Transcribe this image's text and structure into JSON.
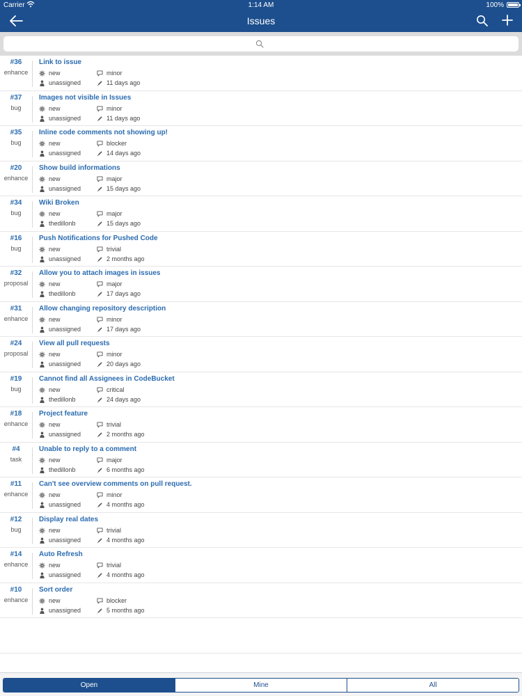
{
  "status_bar": {
    "carrier": "Carrier",
    "time": "1:14 AM",
    "battery": "100%"
  },
  "nav": {
    "title": "Issues"
  },
  "search": {
    "placeholder": ""
  },
  "issues": [
    {
      "number": "#36",
      "kind": "enhance",
      "title": "Link to issue",
      "status": "new",
      "assignee": "unassigned",
      "priority": "minor",
      "updated": "11 days ago"
    },
    {
      "number": "#37",
      "kind": "bug",
      "title": "Images not visible in Issues",
      "status": "new",
      "assignee": "unassigned",
      "priority": "minor",
      "updated": "11 days ago"
    },
    {
      "number": "#35",
      "kind": "bug",
      "title": "Inline code comments not showing up!",
      "status": "new",
      "assignee": "unassigned",
      "priority": "blocker",
      "updated": "14 days ago"
    },
    {
      "number": "#20",
      "kind": "enhance",
      "title": "Show build informations",
      "status": "new",
      "assignee": "unassigned",
      "priority": "major",
      "updated": "15 days ago"
    },
    {
      "number": "#34",
      "kind": "bug",
      "title": "Wiki Broken",
      "status": "new",
      "assignee": "thedillonb",
      "priority": "major",
      "updated": "15 days ago"
    },
    {
      "number": "#16",
      "kind": "bug",
      "title": "Push Notifications for Pushed Code",
      "status": "new",
      "assignee": "unassigned",
      "priority": "trivial",
      "updated": "2 months ago"
    },
    {
      "number": "#32",
      "kind": "proposal",
      "title": "Allow you to attach images in issues",
      "status": "new",
      "assignee": "thedillonb",
      "priority": "major",
      "updated": "17 days ago"
    },
    {
      "number": "#31",
      "kind": "enhance",
      "title": "Allow changing repository description",
      "status": "new",
      "assignee": "unassigned",
      "priority": "minor",
      "updated": "17 days ago"
    },
    {
      "number": "#24",
      "kind": "proposal",
      "title": "View all pull requests",
      "status": "new",
      "assignee": "unassigned",
      "priority": "minor",
      "updated": "20 days ago"
    },
    {
      "number": "#19",
      "kind": "bug",
      "title": "Cannot find all Assignees in CodeBucket",
      "status": "new",
      "assignee": "thedillonb",
      "priority": "critical",
      "updated": "24 days ago"
    },
    {
      "number": "#18",
      "kind": "enhance",
      "title": "Project feature",
      "status": "new",
      "assignee": "unassigned",
      "priority": "trivial",
      "updated": "2 months ago"
    },
    {
      "number": "#4",
      "kind": "task",
      "title": "Unable to reply to a comment",
      "status": "new",
      "assignee": "thedillonb",
      "priority": "major",
      "updated": "6 months ago"
    },
    {
      "number": "#11",
      "kind": "enhance",
      "title": "Can't see overview comments on pull request.",
      "status": "new",
      "assignee": "unassigned",
      "priority": "minor",
      "updated": "4 months ago"
    },
    {
      "number": "#12",
      "kind": "bug",
      "title": "Display real dates",
      "status": "new",
      "assignee": "unassigned",
      "priority": "trivial",
      "updated": "4 months ago"
    },
    {
      "number": "#14",
      "kind": "enhance",
      "title": "Auto   Refresh",
      "status": "new",
      "assignee": "unassigned",
      "priority": "trivial",
      "updated": "4 months ago"
    },
    {
      "number": "#10",
      "kind": "enhance",
      "title": "Sort order",
      "status": "new",
      "assignee": "unassigned",
      "priority": "blocker",
      "updated": "5 months ago"
    }
  ],
  "tabs": [
    {
      "label": "Open",
      "active": true
    },
    {
      "label": "Mine",
      "active": false
    },
    {
      "label": "All",
      "active": false
    }
  ],
  "colors": {
    "accent": "#1d4f8e",
    "link": "#2b6cb0"
  },
  "icons": {
    "back": "arrow-left-icon",
    "search": "search-icon",
    "add": "plus-icon",
    "status": "gear-icon",
    "assignee": "person-icon",
    "priority": "speech-bubble-icon",
    "updated": "pencil-icon"
  }
}
